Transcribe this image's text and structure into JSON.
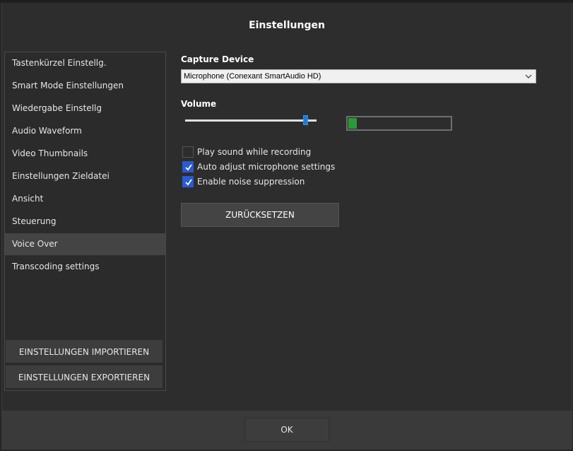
{
  "dialog": {
    "title": "Einstellungen"
  },
  "sidebar": {
    "items": [
      {
        "label": "Tastenkürzel Einstellg.",
        "selected": false
      },
      {
        "label": "Smart Mode Einstellungen",
        "selected": false
      },
      {
        "label": "Wiedergabe Einstellg",
        "selected": false
      },
      {
        "label": "Audio Waveform",
        "selected": false
      },
      {
        "label": "Video Thumbnails",
        "selected": false
      },
      {
        "label": "Einstellungen Zieldatei",
        "selected": false
      },
      {
        "label": "Ansicht",
        "selected": false
      },
      {
        "label": "Steuerung",
        "selected": false
      },
      {
        "label": "Voice Over",
        "selected": true
      },
      {
        "label": "Transcoding settings",
        "selected": false
      }
    ],
    "import_label": "EINSTELLUNGEN IMPORTIEREN",
    "export_label": "EINSTELLUNGEN EXPORTIEREN"
  },
  "voice_over": {
    "capture_device_label": "Capture Device",
    "capture_device_value": "Microphone (Conexant SmartAudio HD)",
    "volume_label": "Volume",
    "volume_level": 0.92,
    "meter_level": 0.08,
    "meter_color": "#2a9a36",
    "options": [
      {
        "label": "Play sound while recording",
        "checked": false
      },
      {
        "label": "Auto adjust microphone settings",
        "checked": true
      },
      {
        "label": "Enable noise suppression",
        "checked": true
      }
    ],
    "reset_label": "ZURÜCKSETZEN"
  },
  "footer": {
    "ok_label": "OK"
  },
  "colors": {
    "accent": "#2a5bd1",
    "slider_thumb": "#1e7bd8",
    "background": "#2d2d2d"
  }
}
